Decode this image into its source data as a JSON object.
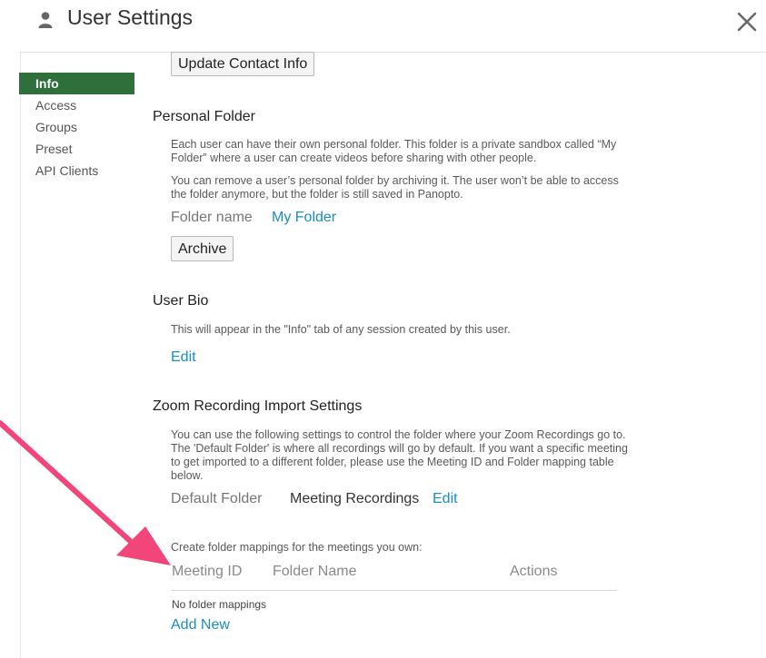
{
  "header": {
    "title": "User Settings",
    "icons": {
      "user": "user-icon",
      "close": "close-icon"
    }
  },
  "sidebar": {
    "items": [
      {
        "label": "Info",
        "active": true
      },
      {
        "label": "Access",
        "active": false
      },
      {
        "label": "Groups",
        "active": false
      },
      {
        "label": "Preset",
        "active": false
      },
      {
        "label": "API Clients",
        "active": false
      }
    ],
    "active_color": "#2e6f3c"
  },
  "contact": {
    "update_button": "Update Contact Info"
  },
  "personal_folder": {
    "title": "Personal Folder",
    "desc1": "Each user can have their own personal folder. This folder is a private sandbox called “My Folder” where a user can create videos before sharing with other people.",
    "desc2": "You can remove a user’s personal folder by archiving it. The user won’t be able to access the folder anymore, but the folder is still saved in Panopto.",
    "folder_name_label": "Folder name",
    "folder_name_value": "My Folder",
    "archive_button": "Archive"
  },
  "user_bio": {
    "title": "User Bio",
    "desc": "This will appear in the \"Info\" tab of any session created by this user.",
    "edit_link": "Edit"
  },
  "zoom": {
    "title": "Zoom Recording Import Settings",
    "desc": "You can use the following settings to control the folder where your Zoom Recordings go to. The 'Default Folder' is where all recordings will go by default. If you want a specific meeting to get imported to a different folder, please use the Meeting ID and Folder mapping table below.",
    "default_folder_label": "Default Folder",
    "default_folder_value": "Meeting Recordings",
    "edit_link": "Edit",
    "mappings_intro": "Create folder mappings for the meetings you own:",
    "columns": [
      "Meeting ID",
      "Folder Name",
      "Actions"
    ],
    "empty_text": "No folder mappings",
    "add_new_link": "Add New"
  },
  "colors": {
    "link": "#1a8fc0",
    "annotation_arrow": "#f2457a"
  }
}
